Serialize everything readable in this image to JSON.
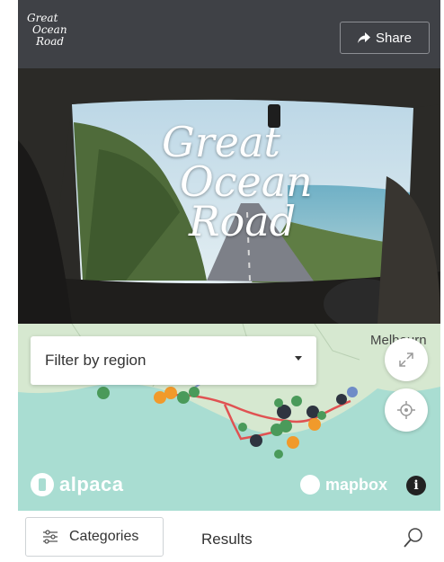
{
  "header": {
    "logo_lines": [
      "Great",
      "Ocean",
      "Road"
    ],
    "share_label": "Share",
    "share_icon": "share-arrow-icon"
  },
  "hero": {
    "title_lines": [
      "Great",
      "Ocean",
      "Road"
    ]
  },
  "map": {
    "filter_placeholder": "Filter by region",
    "place_label": "Melbourn",
    "expand_icon": "expand-icon",
    "locate_icon": "locate-icon",
    "brand_left": "alpaca",
    "brand_right": "mapbox",
    "info_label": "i",
    "colors": {
      "water": "#a9ddd2",
      "land": "#d6e8d0",
      "route": "#e05252",
      "marker_green": "#4a9a5a",
      "marker_orange": "#f19a2b",
      "marker_dark": "#2e3440"
    }
  },
  "bottom": {
    "categories_label": "Categories",
    "categories_icon": "sliders-icon",
    "results_label": "Results",
    "search_icon": "search-icon"
  }
}
